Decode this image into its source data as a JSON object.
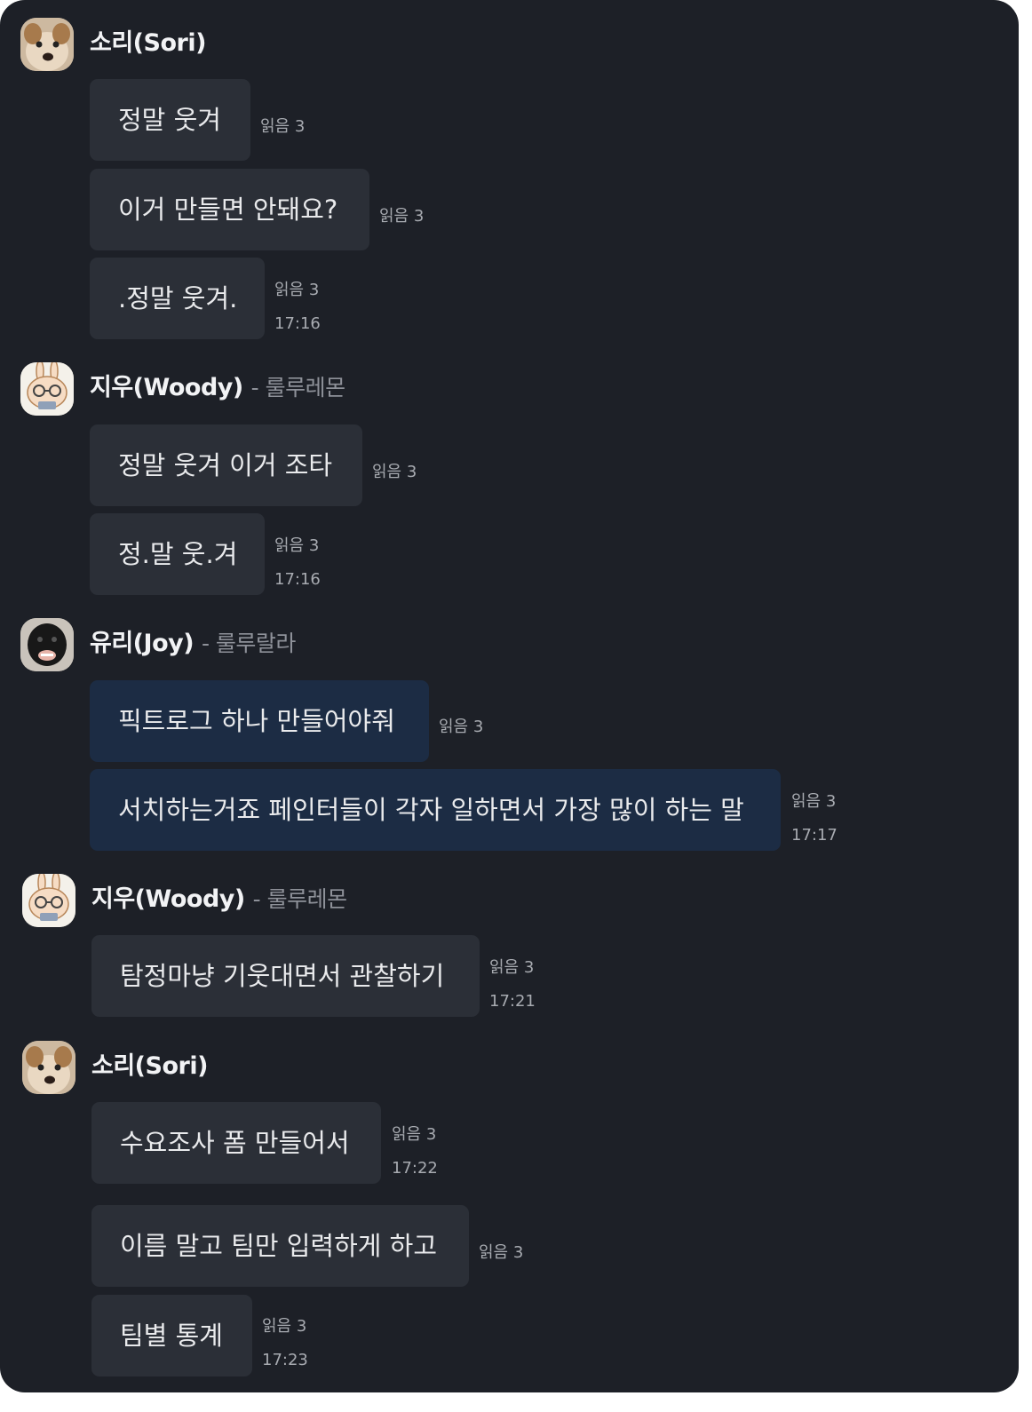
{
  "groups": [
    {
      "name": "소리(Sori)",
      "sub": "",
      "avatar": "shiba-dog-avatar",
      "messages": [
        {
          "text": "정말 웃겨",
          "read": "읽음 3",
          "time": ""
        },
        {
          "text": "이거 만들면 안돼요?",
          "read": "읽음 3",
          "time": ""
        },
        {
          "text": ".정말 웃겨.",
          "read": "읽음 3",
          "time": "17:16"
        }
      ]
    },
    {
      "name": "지우(Woody)",
      "sub": "- 룰루레몬",
      "avatar": "bunny-glasses-avatar",
      "messages": [
        {
          "text": "정말 웃겨 이거 조타",
          "read": "읽음 3",
          "time": ""
        },
        {
          "text": "정.말 웃.겨",
          "read": "읽음 3",
          "time": "17:16"
        }
      ]
    },
    {
      "name": "유리(Joy)",
      "sub": "- 룰루랄라",
      "avatar": "black-dog-avatar",
      "messages": [
        {
          "text": "픽트로그 하나 만들어야줘",
          "read": "읽음 3",
          "time": ""
        },
        {
          "text": "서치하는거죠 페인터들이 각자 일하면서 가장 많이 하는 말",
          "read": "읽음 3",
          "time": "17:17"
        }
      ]
    },
    {
      "name": "지우(Woody)",
      "sub": "- 룰루레몬",
      "avatar": "bunny-glasses-avatar",
      "messages": [
        {
          "text": "탐정마냥 기웃대면서 관찰하기",
          "read": "읽음 3",
          "time": "17:21"
        }
      ]
    },
    {
      "name": "소리(Sori)",
      "sub": "",
      "avatar": "shiba-dog-avatar",
      "messages": [
        {
          "text": "수요조사 폼 만들어서",
          "read": "읽음 3",
          "time": "17:22"
        },
        {
          "text": "이름 말고 팀만 입력하게 하고",
          "read": "읽음 3",
          "time": ""
        },
        {
          "text": "팀별 통계",
          "read": "읽음 3",
          "time": "17:23"
        }
      ]
    }
  ],
  "colors": {
    "background": "#1d2027",
    "bubble": "#2b2f37",
    "bubble_highlight": "#1c2c44",
    "meta_text": "#a8abb1"
  }
}
